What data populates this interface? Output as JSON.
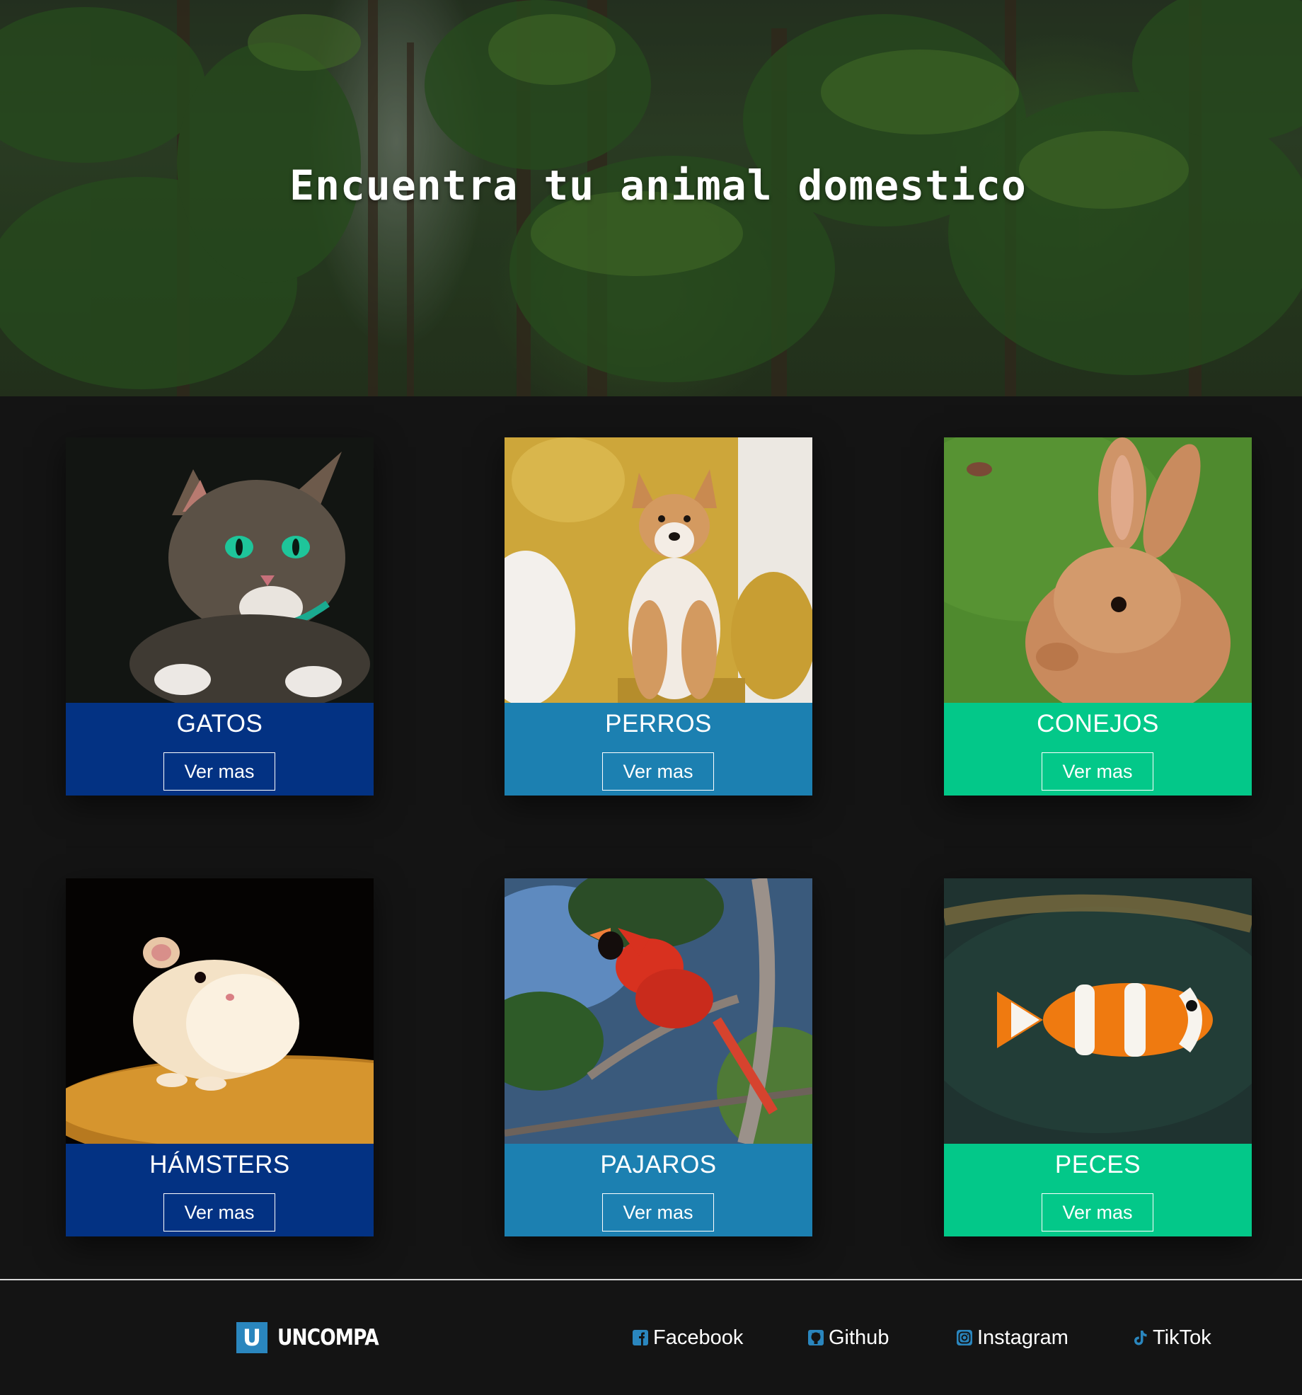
{
  "hero": {
    "title": "Encuentra tu animal domestico"
  },
  "cards": [
    {
      "title": "GATOS",
      "button": "Ver mas",
      "color": "#033283",
      "photo": "cat-photo"
    },
    {
      "title": "PERROS",
      "button": "Ver mas",
      "color": "#1c80b1",
      "photo": "dog-photo"
    },
    {
      "title": "CONEJOS",
      "button": "Ver mas",
      "color": "#03c889",
      "photo": "rabbit-photo"
    },
    {
      "title": "HÁMSTERS",
      "button": "Ver mas",
      "color": "#033283",
      "photo": "hamster-photo"
    },
    {
      "title": "PAJAROS",
      "button": "Ver mas",
      "color": "#1c80b1",
      "photo": "bird-photo"
    },
    {
      "title": "PECES",
      "button": "Ver mas",
      "color": "#03c889",
      "photo": "fish-photo"
    }
  ],
  "footer": {
    "logo_letter": "U",
    "logo_text": "UNCOMPA",
    "links": [
      {
        "label": "Facebook",
        "icon": "facebook-icon"
      },
      {
        "label": "Github",
        "icon": "github-icon"
      },
      {
        "label": "Instagram",
        "icon": "instagram-icon"
      },
      {
        "label": "TikTok",
        "icon": "tiktok-icon"
      }
    ],
    "icon_color": "#2a86be"
  },
  "colors": {
    "page_background": "#141414",
    "divider": "#d8d8d8"
  }
}
